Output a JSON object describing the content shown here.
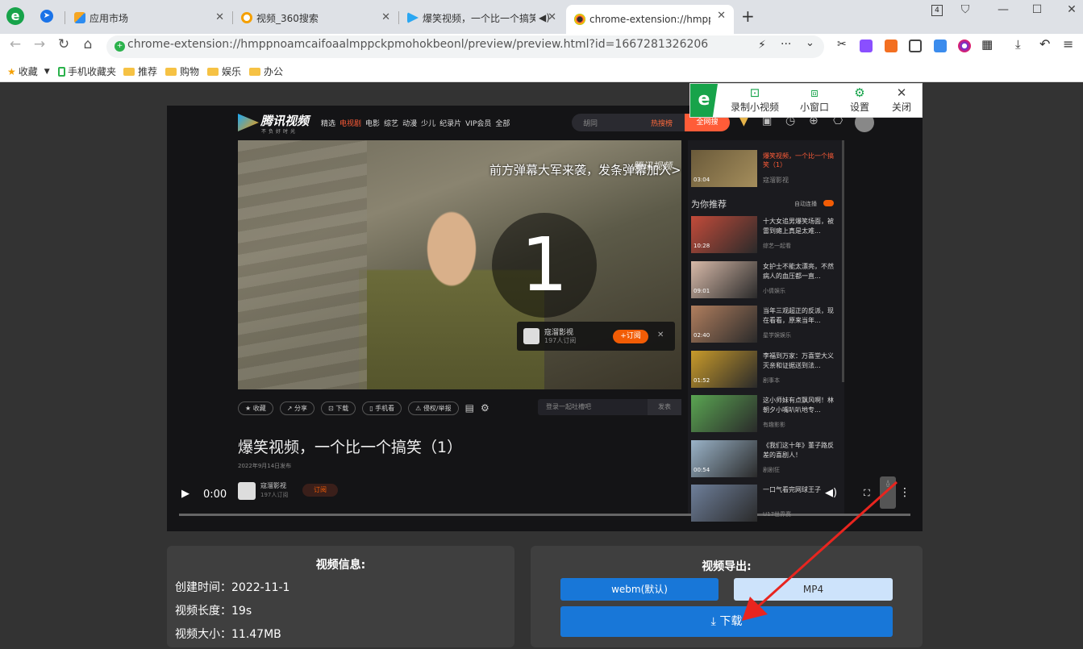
{
  "browser": {
    "tabs": [
      {
        "label": "应用市场"
      },
      {
        "label": "视频_360搜索"
      },
      {
        "label": "爆笑视频，一个比一个搞笑"
      },
      {
        "label": "chrome-extension://hmppn"
      }
    ],
    "new_tab": "+",
    "window_controls": {
      "minimize": "—",
      "maximize": "☐",
      "close": "✕",
      "badge": "4"
    },
    "url": "chrome-extension://hmppnoamcaifoaalmppckpmohokbeonl/preview/preview.html?id=1667281326206",
    "bookmarks": [
      {
        "label": "收藏"
      },
      {
        "label": "手机收藏夹"
      },
      {
        "label": "推荐"
      },
      {
        "label": "购物"
      },
      {
        "label": "娱乐"
      },
      {
        "label": "办公"
      }
    ]
  },
  "recorder_toolbar": {
    "buttons": [
      {
        "label": "录制小视频"
      },
      {
        "label": "小窗口"
      },
      {
        "label": "设置"
      },
      {
        "label": "关闭"
      }
    ]
  },
  "video_frame": {
    "site": {
      "logo": "腾讯视频",
      "slogan": "不负好时光",
      "nav": [
        "精选",
        "电视剧",
        "电影",
        "综艺",
        "动漫",
        "少儿",
        "纪录片",
        "VIP会员",
        "全部"
      ],
      "search_placeholder": "胡同",
      "hot": "热搜榜",
      "search_btn": "全网搜"
    },
    "player": {
      "danmaku": "前方弹幕大军来袭，发条弹幕加入>",
      "watermark": "腾讯视频",
      "countdown": "1",
      "uploader": "寇溜影视",
      "subs": "197人订阅",
      "follow": "+订阅"
    },
    "action_bar": [
      "收藏",
      "分享",
      "下载",
      "手机看",
      "侵权/举报"
    ],
    "comment_placeholder": "登录一起吐槽吧",
    "send": "发表",
    "title": "爆笑视频，一个比一个搞笑（1）",
    "date": "2022年9月14日发布",
    "channel": "寇溜影视",
    "channel_subs": "197人订阅",
    "sub_btn": "订阅",
    "time": "0:00",
    "sidebar": {
      "top_item": {
        "title": "爆笑视频，一个比一个搞笑（1）",
        "by": "寇溜影视",
        "dur": "03:04"
      },
      "section": "为你推荐",
      "autoplay": "自动连播",
      "items": [
        {
          "title": "十大女追男爆笑场面，被雷到瘫上真是太难...",
          "by": "综艺一起看",
          "dur": "10:28"
        },
        {
          "title": "女护士不能太漂亮，不然病人的血压都一直...",
          "by": "小倩娱乐",
          "dur": "09:01"
        },
        {
          "title": "当年三观超正的反派，现在看看，原来当年...",
          "by": "星学娱娱乐",
          "dur": "02:40"
        },
        {
          "title": "李福到万家：万喜堂大义灭亲和证据送到法...",
          "by": "剧事本",
          "dur": "01:52"
        },
        {
          "title": "这小师妹有点飘风啊！林朝夕小嘴叭叭地专...",
          "by": "有趣影影",
          "dur": ""
        },
        {
          "title": "《我们这十年》董子路反差的喜剧人！",
          "by": "剧剧狂",
          "dur": "00:54"
        },
        {
          "title": "一口气看完网球王子",
          "by": "U17世界赛",
          "dur": ""
        }
      ]
    }
  },
  "info_panel": {
    "title": "视频信息:",
    "created_label": "创建时间：",
    "created": "2022-11-1",
    "length_label": "视频长度：",
    "length": "19s",
    "size_label": "视频大小：",
    "size": "11.47MB"
  },
  "export_panel": {
    "title": "视频导出:",
    "webm": "webm(默认)",
    "mp4": "MP4",
    "download": "下载"
  },
  "colors": {
    "accent_blue": "#1877d8",
    "orange": "#f25c05",
    "green": "#15a34a",
    "arrow_red": "#e8251f"
  }
}
